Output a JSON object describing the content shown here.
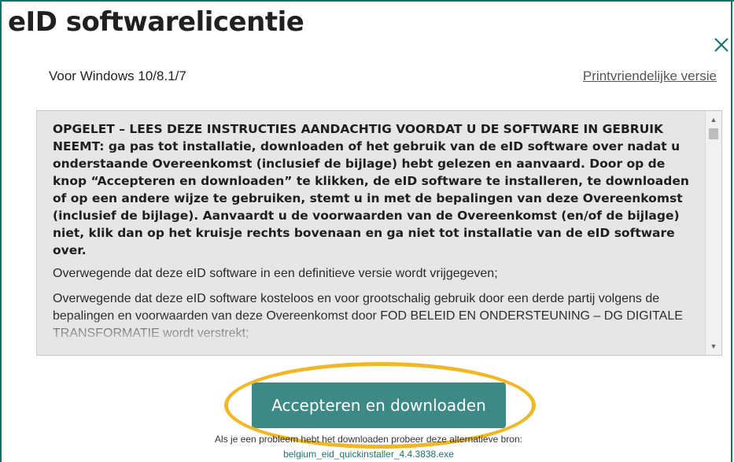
{
  "modal": {
    "title": "eID softwarelicentie",
    "subtitle": "Voor Windows 10/8.1/7",
    "print_link": "Printvriendelijke versie"
  },
  "license": {
    "warning": "OPGELET – LEES DEZE INSTRUCTIES AANDACHTIG VOORDAT U DE SOFTWARE IN GEBRUIK NEEMT: ga pas tot installatie, downloaden of het gebruik van de eID software over nadat u onderstaande Overeenkomst (inclusief  de bijlage) hebt gelezen en aanvaard. Door op de knop “Accepteren en downloaden” te klikken, de eID software te installeren, te downloaden of op een andere wijze te gebruiken, stemt u in met de bepalingen van deze Overeenkomst (inclusief de bijlage). Aanvaardt u de voorwaarden van de Overeenkomst (en/of de bijlage) niet, klik dan op het kruisje rechts bovenaan en ga niet tot installatie van de eID software over.",
    "paragraphs": [
      "Overwegende dat deze eID software in een definitieve versie wordt vrijgegeven;",
      "Overwegende dat deze eID software kosteloos en voor grootschalig gebruik door een derde partij volgens de bepalingen en voorwaarden van deze Overeenkomst door FOD BELEID EN ONDERSTEUNING – DG DIGITALE TRANSFORMATIE wordt verstrekt;"
    ]
  },
  "actions": {
    "accept_label": "Accepteren en downloaden",
    "alt_note": "Als je een probleem hebt het downloaden probeer deze alternatieve bron:",
    "alt_link": "belgium_eid_quickinstaller_4.4.3838.exe"
  },
  "colors": {
    "accent": "#1a7570",
    "highlight": "#f0b828"
  }
}
